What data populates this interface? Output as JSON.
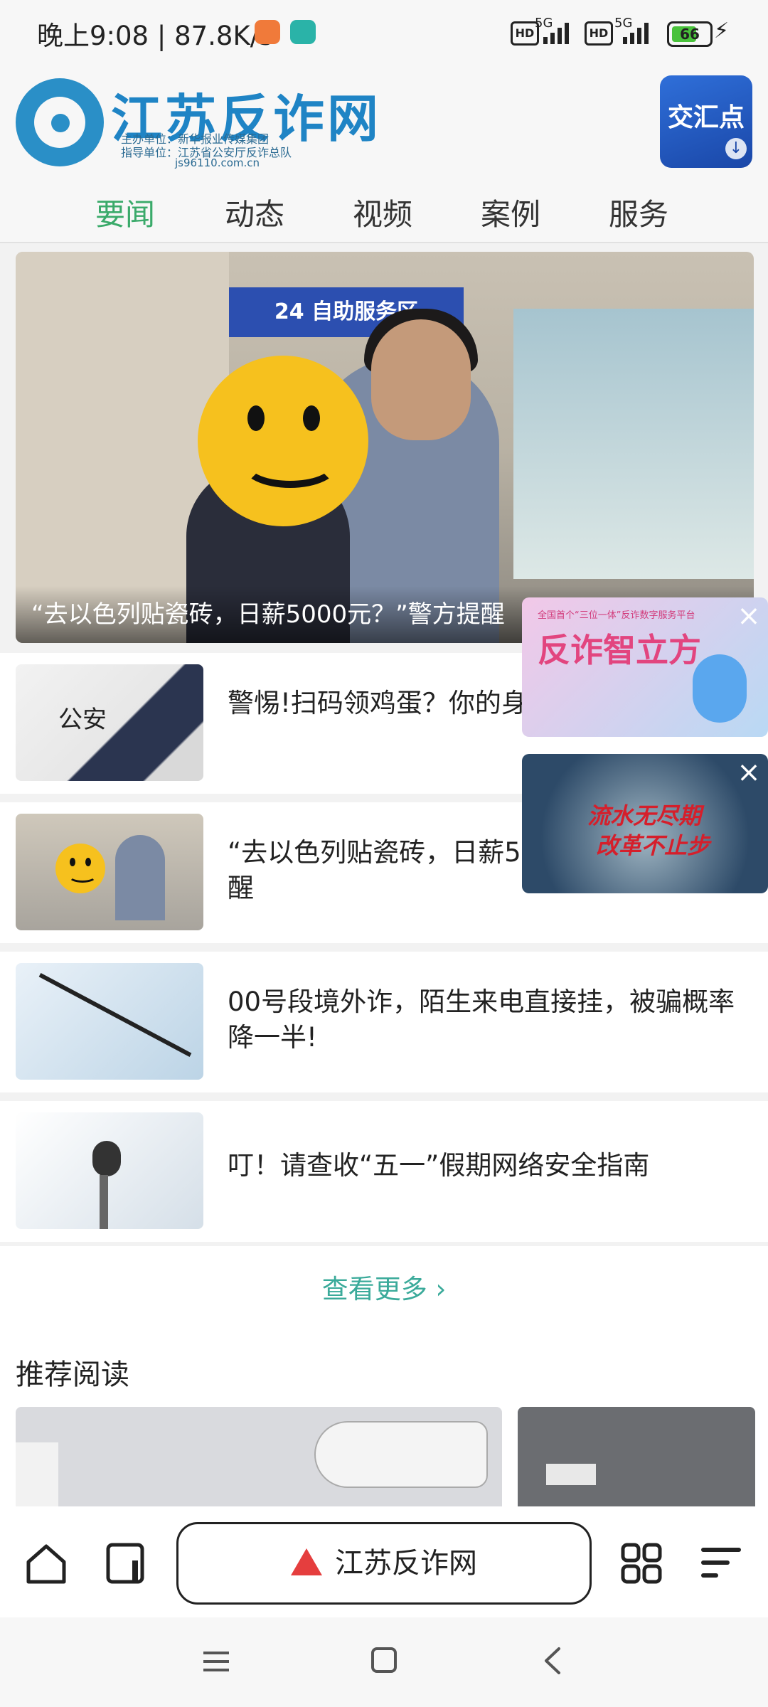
{
  "status": {
    "time": "晚上9:08",
    "speed": "87.8K/s",
    "sim1_label": "5G",
    "sim2_label": "5G",
    "hd1": "HD",
    "hd2": "HD",
    "battery": "66"
  },
  "header": {
    "site_title": "江苏反诈网",
    "sponsor_line": "主办单位：新华报业传媒集团",
    "guide_line": "指导单位：江苏省公安厅反诈总队",
    "url": "js96110.com.cn",
    "app_badge": "交汇点"
  },
  "tabs": [
    {
      "label": "要闻",
      "active": true
    },
    {
      "label": "动态",
      "active": false
    },
    {
      "label": "视频",
      "active": false
    },
    {
      "label": "案例",
      "active": false
    },
    {
      "label": "服务",
      "active": false
    }
  ],
  "hero": {
    "sign_text": "24 自助服务区",
    "caption": "“去以色列贴瓷砖，日薪5000元？”警方提醒"
  },
  "news": [
    {
      "title": "警惕!扫码领鸡蛋？你的身份信息可能被卖!"
    },
    {
      "title": "“去以色列贴瓷砖，日薪5000元？”警方提醒"
    },
    {
      "title": "00号段境外诈，陌生来电直接挂，被骗概率降一半!"
    },
    {
      "title": "叮！请查收“五一”假期网络安全指南"
    }
  ],
  "more_label": "查看更多",
  "recommended": {
    "title": "推荐阅读"
  },
  "ads": {
    "ad1_title": "反诈智立方",
    "ad1_top": "全国首个“三位一体”反诈数字服务平台",
    "ad2_title": "流水无尽期",
    "ad2_subtitle": "改革不止步"
  },
  "bottom": {
    "address_text": "江苏反诈网"
  },
  "colors": {
    "accent_green": "#3aaa6a",
    "brand_blue": "#1f84c5",
    "more_teal": "#3aaa9a",
    "warning_red": "#e53e3e"
  }
}
